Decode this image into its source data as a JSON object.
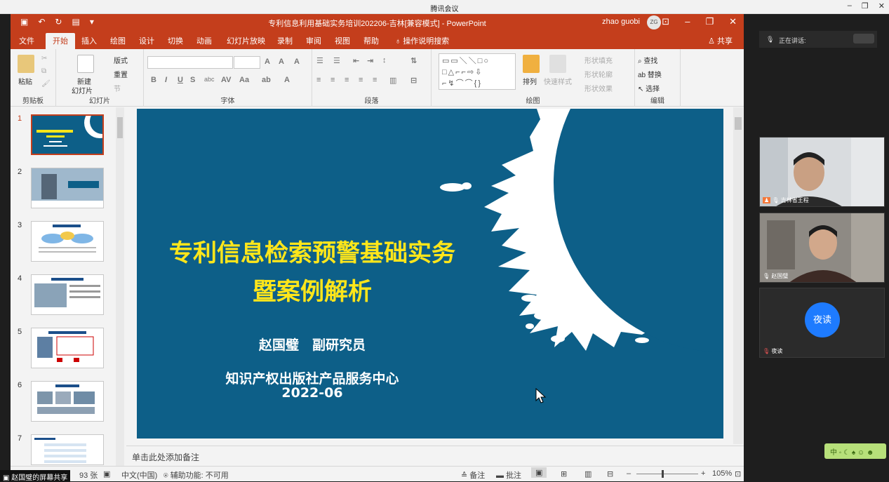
{
  "meeting": {
    "window_title": "腾讯会议",
    "speaking_label": "正在讲话:",
    "participants": [
      {
        "name": "吉林省王程",
        "has_video": true
      },
      {
        "name": "赵国璧",
        "has_video": true
      },
      {
        "name": "夜读",
        "has_video": false,
        "avatar_text": "夜读"
      }
    ],
    "share_badge": "赵国璧的屏幕共享",
    "ime_text": "中"
  },
  "ppt": {
    "doc_title": "专利信息利用基础实务培训202206-吉林[兼容模式] - PowerPoint",
    "user_name": "zhao guobi",
    "user_initials": "ZG",
    "tabs": [
      "文件",
      "开始",
      "插入",
      "绘图",
      "设计",
      "切换",
      "动画",
      "幻灯片放映",
      "录制",
      "审阅",
      "视图",
      "帮助"
    ],
    "active_tab": "开始",
    "tell_me": "操作说明搜索",
    "share_label": "共享",
    "ribbon": {
      "clipboard": {
        "label": "剪贴板",
        "paste": "粘贴"
      },
      "slides": {
        "label": "幻灯片",
        "new_slide_1": "新建",
        "new_slide_2": "幻灯片",
        "layout": "版式",
        "reset": "重置",
        "section": "节"
      },
      "font": {
        "label": "字体"
      },
      "paragraph": {
        "label": "段落"
      },
      "drawing": {
        "label": "绘图",
        "arrange": "排列",
        "quick_styles": "快速样式",
        "shape_fill": "形状填充",
        "shape_outline": "形状轮廓",
        "shape_effects": "形状效果"
      },
      "editing": {
        "label": "编辑",
        "find": "查找",
        "replace": "替换",
        "select": "选择"
      }
    },
    "slide": {
      "title_line1": "专利信息检索预警基础实务",
      "title_line2": "暨案例解析",
      "author": "赵国璧　副研究员",
      "org": "知识产权出版社产品服务中心",
      "date": "2022-06"
    },
    "thumbnails": [
      {
        "num": "1",
        "active": true
      },
      {
        "num": "2",
        "active": false
      },
      {
        "num": "3",
        "active": false
      },
      {
        "num": "4",
        "active": false
      },
      {
        "num": "5",
        "active": false
      },
      {
        "num": "6",
        "active": false
      },
      {
        "num": "7",
        "active": false
      }
    ],
    "notes_placeholder": "单击此处添加备注",
    "status": {
      "slide_count": "93 张",
      "language": "中文(中国)",
      "accessibility": "辅助功能: 不可用",
      "notes": "备注",
      "comments": "批注",
      "zoom": "105%"
    }
  }
}
